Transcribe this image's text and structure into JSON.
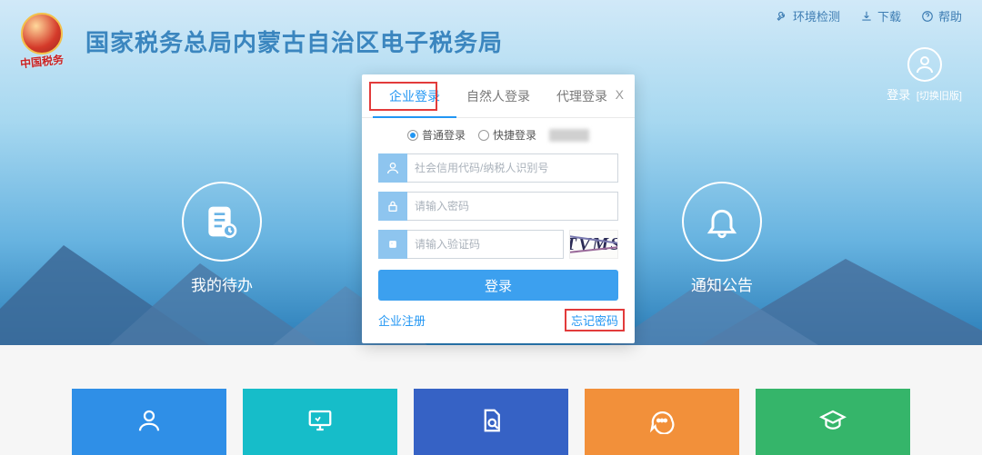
{
  "header": {
    "title": "国家税务总局内蒙古自治区电子税务局",
    "emblem_text": "中国税务",
    "util_links": {
      "env_check": "环境检测",
      "download": "下载",
      "help": "帮助"
    },
    "login_label": "登录",
    "login_switch": "[切换旧版]"
  },
  "features": {
    "todo": "我的待办",
    "notice": "通知公告"
  },
  "modal": {
    "tabs": {
      "enterprise": "企业登录",
      "natural": "自然人登录",
      "agent": "代理登录"
    },
    "close": "X",
    "login_types": {
      "normal": "普通登录",
      "quick": "快捷登录"
    },
    "fields": {
      "id_placeholder": "社会信用代码/纳税人识别号",
      "password_placeholder": "请输入密码",
      "captcha_placeholder": "请输入验证码",
      "captcha_text": "TVMS"
    },
    "submit": "登录",
    "register": "企业注册",
    "forgot": "忘记密码"
  },
  "tiles": [
    {
      "label": "",
      "color": "c-blue",
      "icon": "user"
    },
    {
      "label": "",
      "color": "c-teal",
      "icon": "monitor"
    },
    {
      "label": "",
      "color": "c-navy",
      "icon": "doc-search"
    },
    {
      "label": "",
      "color": "c-orange",
      "icon": "chat"
    },
    {
      "label": "",
      "color": "c-green",
      "icon": "grad-cap"
    }
  ]
}
